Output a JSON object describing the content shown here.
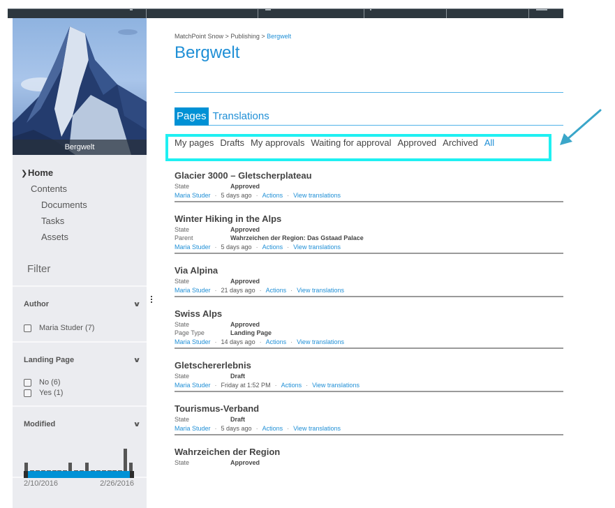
{
  "site": {
    "hero_caption": "Bergwelt"
  },
  "sidebar": {
    "nav": [
      {
        "label": "Home",
        "level": 0,
        "current": true
      },
      {
        "label": "Contents",
        "level": 1
      },
      {
        "label": "Documents",
        "level": 2
      },
      {
        "label": "Tasks",
        "level": 2
      },
      {
        "label": "Assets",
        "level": 2
      }
    ],
    "filter_title": "Filter",
    "facets": {
      "author": {
        "title": "Author",
        "options": [
          {
            "label": "Maria Studer (7)",
            "checked": false
          }
        ]
      },
      "landing_page": {
        "title": "Landing Page",
        "options": [
          {
            "label": "No (6)",
            "checked": false
          },
          {
            "label": "Yes (1)",
            "checked": false
          }
        ]
      },
      "modified": {
        "title": "Modified",
        "range_start": "2/10/2016",
        "range_end": "2/26/2016",
        "histogram_counts": [
          1,
          0,
          0,
          0,
          0,
          0,
          0,
          0,
          1,
          0,
          0,
          1,
          0,
          0,
          0,
          0,
          0,
          0,
          3,
          1
        ]
      }
    }
  },
  "main": {
    "breadcrumb": [
      {
        "label": "MatchPoint Snow",
        "current": false
      },
      {
        "label": "Publishing",
        "current": false
      },
      {
        "label": "Bergwelt",
        "current": true
      }
    ],
    "breadcrumb_separator": " > ",
    "page_title": "Bergwelt",
    "tabs": [
      {
        "label": "Pages",
        "active": true
      },
      {
        "label": "Translations",
        "active": false
      }
    ],
    "subtabs": [
      {
        "label": "My pages",
        "active": false
      },
      {
        "label": "Drafts",
        "active": false
      },
      {
        "label": "My approvals",
        "active": false
      },
      {
        "label": "Waiting for approval",
        "active": false
      },
      {
        "label": "Approved",
        "active": false
      },
      {
        "label": "Archived",
        "active": false
      },
      {
        "label": "All",
        "active": true
      }
    ],
    "items": [
      {
        "title": "Glacier 3000 – Gletscherplateau",
        "props": [
          {
            "k": "State",
            "v": "Approved"
          }
        ],
        "author": "Maria Studer",
        "modified": "5 days ago",
        "actions": "Actions",
        "translations": "View translations"
      },
      {
        "title": "Winter Hiking in the Alps",
        "props": [
          {
            "k": "State",
            "v": "Approved"
          },
          {
            "k": "Parent",
            "v": "Wahrzeichen der Region: Das Gstaad Palace"
          }
        ],
        "author": "Maria Studer",
        "modified": "5 days ago",
        "actions": "Actions",
        "translations": "View translations"
      },
      {
        "title": "Via Alpina",
        "props": [
          {
            "k": "State",
            "v": "Approved"
          }
        ],
        "author": "Maria Studer",
        "modified": "21 days ago",
        "actions": "Actions",
        "translations": "View translations"
      },
      {
        "title": "Swiss Alps",
        "props": [
          {
            "k": "State",
            "v": "Approved"
          },
          {
            "k": "Page Type",
            "v": "Landing Page"
          }
        ],
        "author": "Maria Studer",
        "modified": "14 days ago",
        "actions": "Actions",
        "translations": "View translations"
      },
      {
        "title": "Gletschererlebnis",
        "props": [
          {
            "k": "State",
            "v": "Draft"
          }
        ],
        "author": "Maria Studer",
        "modified": "Friday at 1:52 PM",
        "actions": "Actions",
        "translations": "View translations"
      },
      {
        "title": "Tourismus-Verband",
        "props": [
          {
            "k": "State",
            "v": "Draft"
          }
        ],
        "author": "Maria Studer",
        "modified": "5 days ago",
        "actions": "Actions",
        "translations": "View translations"
      },
      {
        "title": "Wahrzeichen der Region",
        "props": [
          {
            "k": "State",
            "v": "Approved"
          }
        ]
      }
    ]
  },
  "annotation": {
    "highlight_color": "#1ff0f2",
    "arrow_color": "#3aa6c9"
  },
  "colors": {
    "accent": "#1f8fd6",
    "tab_active_bg": "#0091d5",
    "sidebar_bg": "#ebecf0",
    "topbar_bg": "#2d373e",
    "range_fill": "#0092d6"
  }
}
